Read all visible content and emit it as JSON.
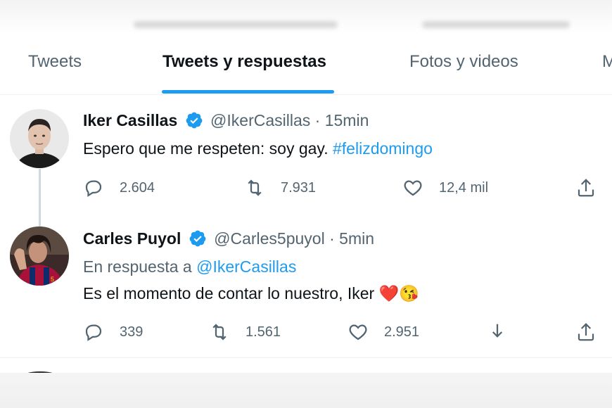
{
  "tabs": [
    "Tweets",
    "Tweets y respuestas",
    "Fotos y videos",
    "M"
  ],
  "active_tab_index": 1,
  "colors": {
    "accent": "#1d9bf0",
    "like_red": "#e0245e",
    "secondary_text": "#536471"
  },
  "tweets": [
    {
      "name": "Iker Casillas",
      "handle": "@IkerCasillas",
      "separator": "·",
      "time": "15min",
      "text": "Espero que me respeten: soy gay.",
      "hashtag": "#felizdomingo",
      "replies": "2.604",
      "retweets": "7.931",
      "likes": "12,4 mil"
    },
    {
      "name": "Carles Puyol",
      "handle": "@Carles5puyol",
      "separator": "·",
      "time": "5min",
      "reply_prefix": "En respuesta a",
      "reply_to": "@IkerCasillas",
      "text": "Es el momento de contar lo nuestro, Iker",
      "emoji": "❤️😘",
      "replies": "339",
      "retweets": "1.561",
      "likes": "2.951"
    }
  ],
  "icons": [
    "reply-icon",
    "retweet-icon",
    "like-icon",
    "share-icon",
    "download-icon",
    "verified-badge-icon"
  ]
}
